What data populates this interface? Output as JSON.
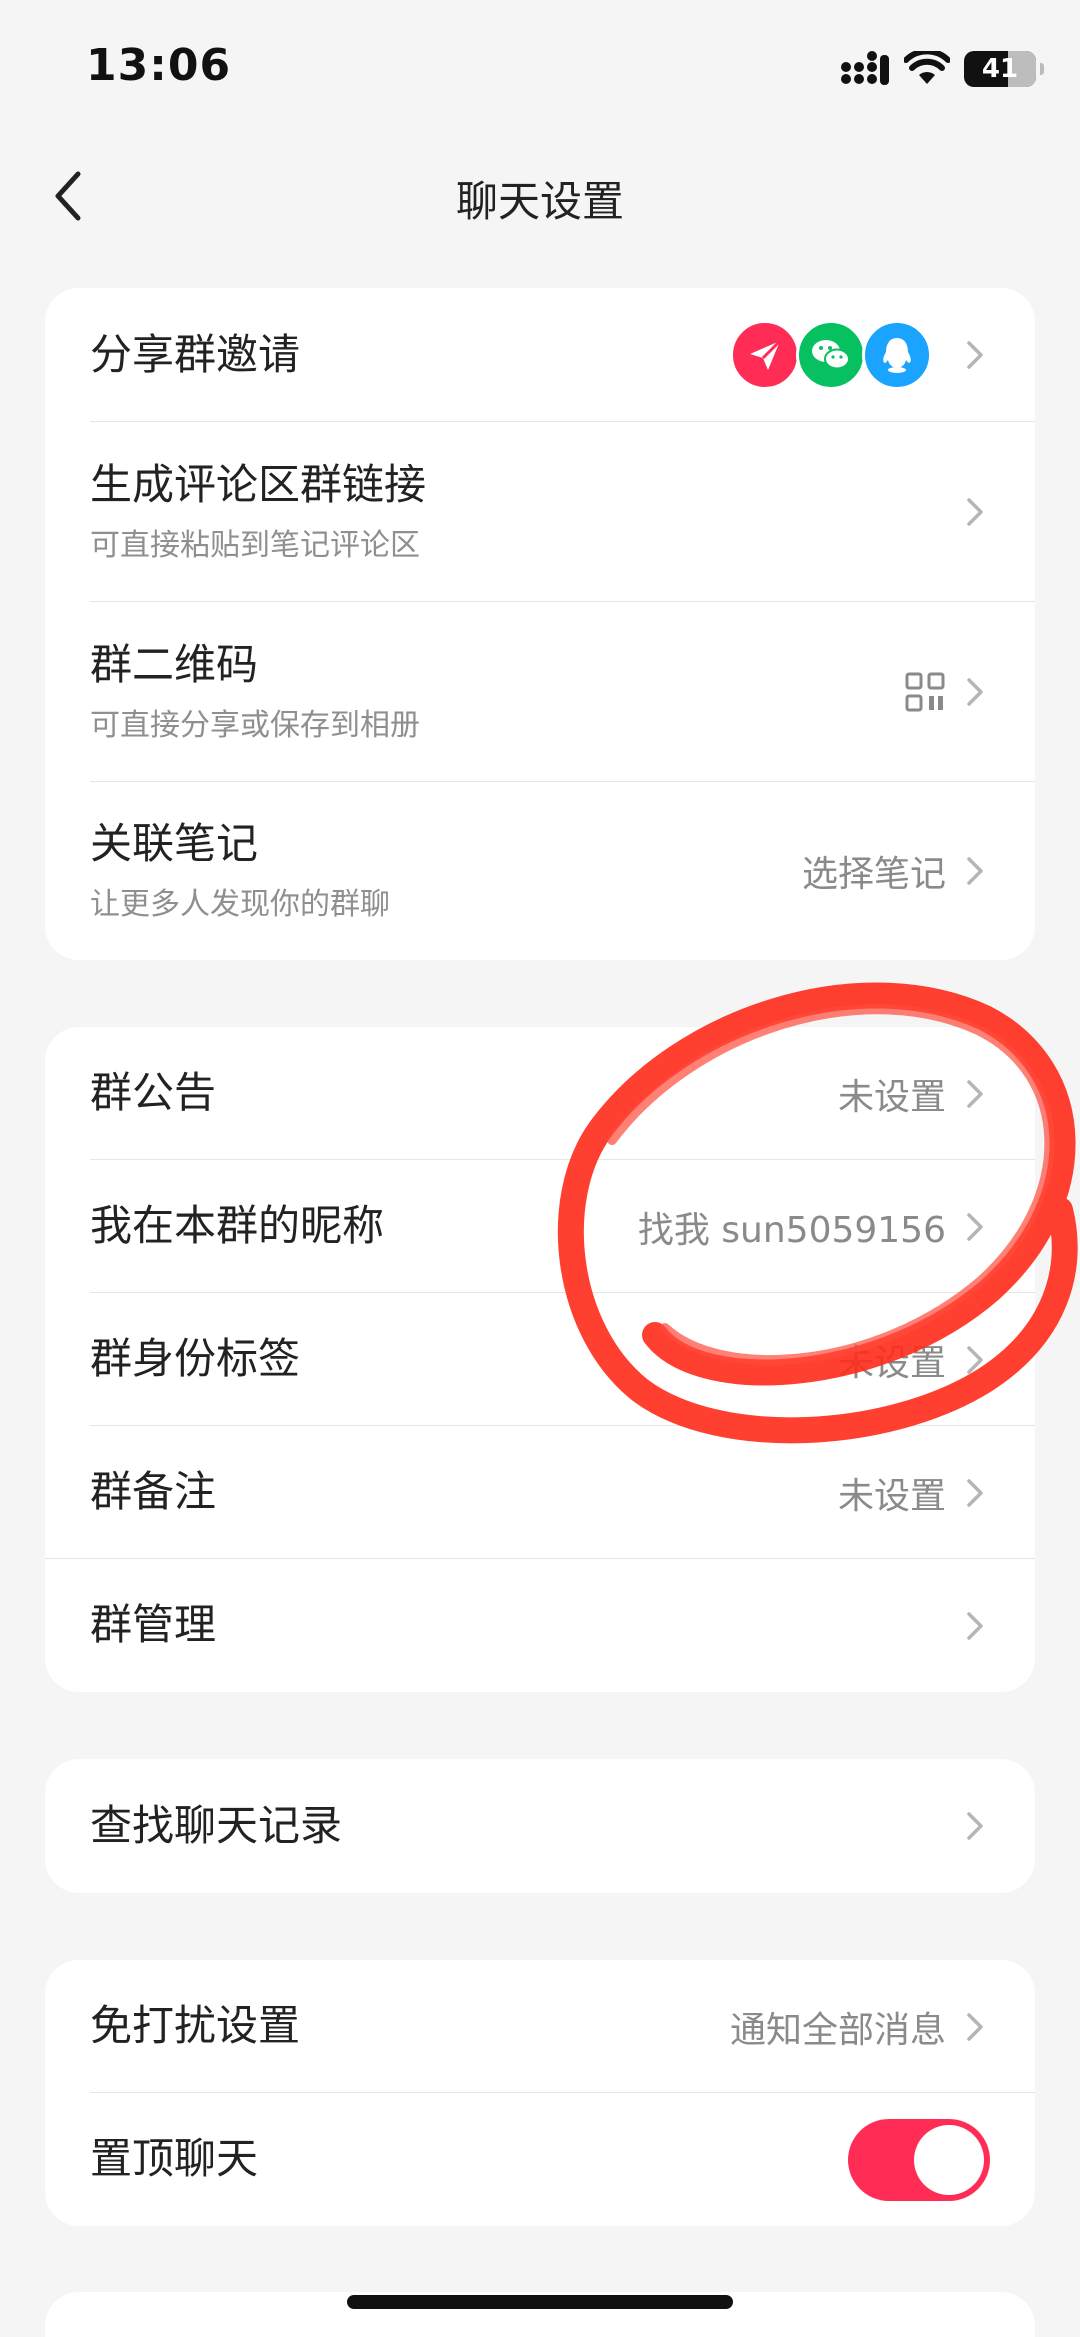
{
  "status_bar": {
    "time": "13:06",
    "battery": "41"
  },
  "nav": {
    "title": "聊天设置"
  },
  "colors": {
    "accent": "#ff2d55",
    "share_red": "#ff2d55",
    "share_green": "#07c160",
    "share_blue": "#1aa3ff",
    "annotation": "#ff2a1a"
  },
  "group1": {
    "share": {
      "title": "分享群邀请",
      "icons": [
        "paper-plane-icon",
        "wechat-icon",
        "qq-icon"
      ]
    },
    "comment_link": {
      "title": "生成评论区群链接",
      "subtitle": "可直接粘贴到笔记评论区"
    },
    "qr": {
      "title": "群二维码",
      "subtitle": "可直接分享或保存到相册",
      "icon": "qr-code-icon"
    },
    "note": {
      "title": "关联笔记",
      "subtitle": "让更多人发现你的群聊",
      "value": "选择笔记"
    }
  },
  "group2": {
    "notice": {
      "title": "群公告",
      "value": "未设置"
    },
    "nickname": {
      "title": "我在本群的昵称",
      "value": "找我 sun5059156"
    },
    "tag": {
      "title": "群身份标签",
      "value": "未设置"
    },
    "remark": {
      "title": "群备注",
      "value": "未设置"
    },
    "manage": {
      "title": "群管理"
    }
  },
  "group3": {
    "search": {
      "title": "查找聊天记录"
    }
  },
  "group4": {
    "dnd": {
      "title": "免打扰设置",
      "value": "通知全部消息"
    },
    "pin": {
      "title": "置顶聊天",
      "on": true
    }
  }
}
